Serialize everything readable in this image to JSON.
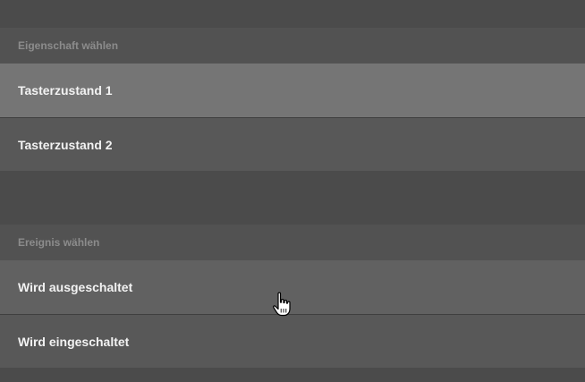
{
  "property_section": {
    "header": "Eigenschaft wählen",
    "items": [
      {
        "label": "Tasterzustand 1",
        "state": "selected"
      },
      {
        "label": "Tasterzustand 2",
        "state": "normal"
      }
    ]
  },
  "event_section": {
    "header": "Ereignis wählen",
    "items": [
      {
        "label": "Wird ausgeschaltet",
        "state": "hovered"
      },
      {
        "label": "Wird eingeschaltet",
        "state": "normal"
      }
    ]
  },
  "cursor": {
    "icon": "hand-pointer-icon"
  },
  "colors": {
    "background": "#4b4b4b",
    "header_bg": "#525252",
    "item_bg": "#585858",
    "item_selected_bg": "#757575",
    "item_hover_bg": "#616161",
    "header_text": "#8c8c8c",
    "item_text": "#f2f2f2"
  }
}
